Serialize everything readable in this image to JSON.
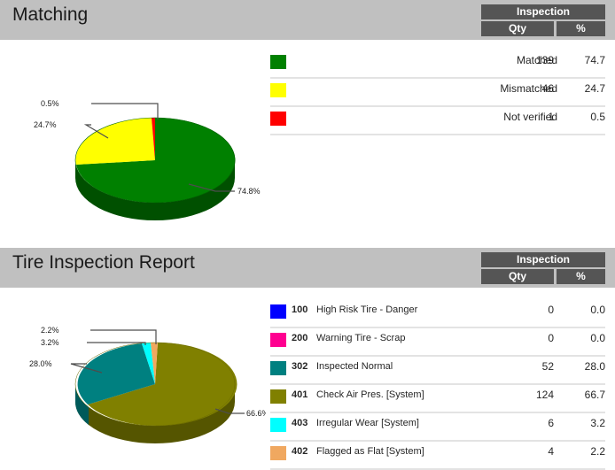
{
  "sections": [
    {
      "title": "Matching",
      "header": {
        "group": "Inspection",
        "qty": "Qty",
        "pct": "%"
      },
      "label_style": "right",
      "rows": [
        {
          "color": "#008000",
          "code": "",
          "label": "Matched",
          "qty": "139",
          "pct": "74.7"
        },
        {
          "color": "#ffff00",
          "code": "",
          "label": "Mismatched",
          "qty": "46",
          "pct": "24.7"
        },
        {
          "color": "#ff0000",
          "code": "",
          "label": "Not verified",
          "qty": "1",
          "pct": "0.5"
        }
      ],
      "callouts": [
        {
          "text": "0.5%"
        },
        {
          "text": "24.7%"
        },
        {
          "text": "74.8%"
        }
      ]
    },
    {
      "title": "Tire Inspection Report",
      "header": {
        "group": "Inspection",
        "qty": "Qty",
        "pct": "%"
      },
      "label_style": "left",
      "rows": [
        {
          "color": "#0000ff",
          "code": "100",
          "label": "High Risk Tire - Danger",
          "qty": "0",
          "pct": "0.0"
        },
        {
          "color": "#ff0090",
          "code": "200",
          "label": "Warning Tire - Scrap",
          "qty": "0",
          "pct": "0.0"
        },
        {
          "color": "#008080",
          "code": "302",
          "label": "Inspected Normal",
          "qty": "52",
          "pct": "28.0"
        },
        {
          "color": "#808000",
          "code": "401",
          "label": "Check Air Pres. [System]",
          "qty": "124",
          "pct": "66.7"
        },
        {
          "color": "#00ffff",
          "code": "403",
          "label": "Irregular Wear [System]",
          "qty": "6",
          "pct": "3.2"
        },
        {
          "color": "#f0a860",
          "code": "402",
          "label": "Flagged as Flat [System]",
          "qty": "4",
          "pct": "2.2"
        }
      ],
      "callouts": [
        {
          "text": "2.2%"
        },
        {
          "text": "3.2%"
        },
        {
          "text": "28.0%"
        },
        {
          "text": "66.6%"
        }
      ]
    }
  ],
  "chart_data": [
    {
      "type": "pie",
      "title": "Matching",
      "categories": [
        "Matched",
        "Mismatched",
        "Not verified"
      ],
      "values": [
        139,
        46,
        1
      ],
      "percentages": [
        74.7,
        24.7,
        0.5
      ],
      "slice_labels": [
        "74.8%",
        "24.7%",
        "0.5%"
      ],
      "colors": [
        "#008000",
        "#ffff00",
        "#ff0000"
      ],
      "legend_position": "right",
      "three_d": true
    },
    {
      "type": "pie",
      "title": "Tire Inspection Report",
      "categories": [
        "High Risk Tire - Danger",
        "Warning Tire - Scrap",
        "Inspected Normal",
        "Check Air Pres. [System]",
        "Irregular Wear [System]",
        "Flagged as Flat [System]"
      ],
      "codes": [
        "100",
        "200",
        "302",
        "401",
        "403",
        "402"
      ],
      "values": [
        0,
        0,
        52,
        124,
        6,
        4
      ],
      "percentages": [
        0.0,
        0.0,
        28.0,
        66.7,
        3.2,
        2.2
      ],
      "slice_labels": [
        "66.6%",
        "28.0%",
        "3.2%",
        "2.2%"
      ],
      "colors": [
        "#0000ff",
        "#ff0090",
        "#008080",
        "#808000",
        "#00ffff",
        "#f0a860"
      ],
      "legend_position": "right",
      "three_d": true
    }
  ]
}
